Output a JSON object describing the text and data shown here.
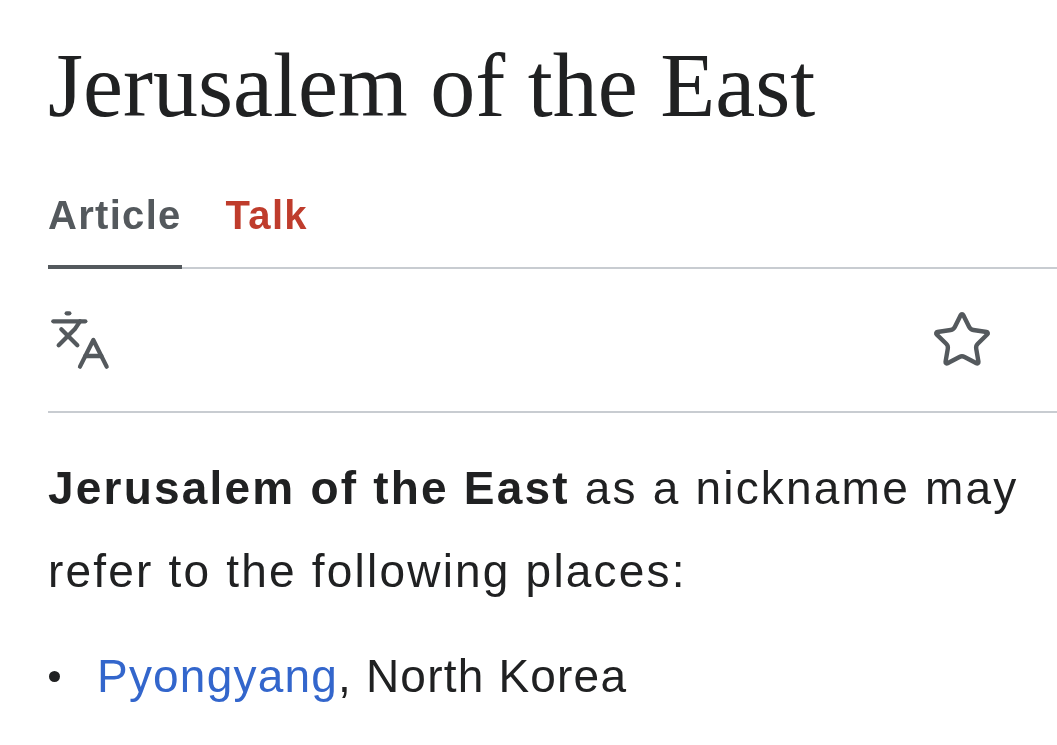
{
  "title": "Jerusalem of the East",
  "tabs": [
    {
      "label": "Article",
      "selected": true,
      "missing": false
    },
    {
      "label": "Talk",
      "selected": false,
      "missing": true
    }
  ],
  "toolbar": {
    "watched": false
  },
  "intro": "**Jerusalem of the East** as a nickname may refer to the following places:",
  "places": [
    {
      "link": "Pyongyang",
      "text": ", North Korea"
    }
  ]
}
